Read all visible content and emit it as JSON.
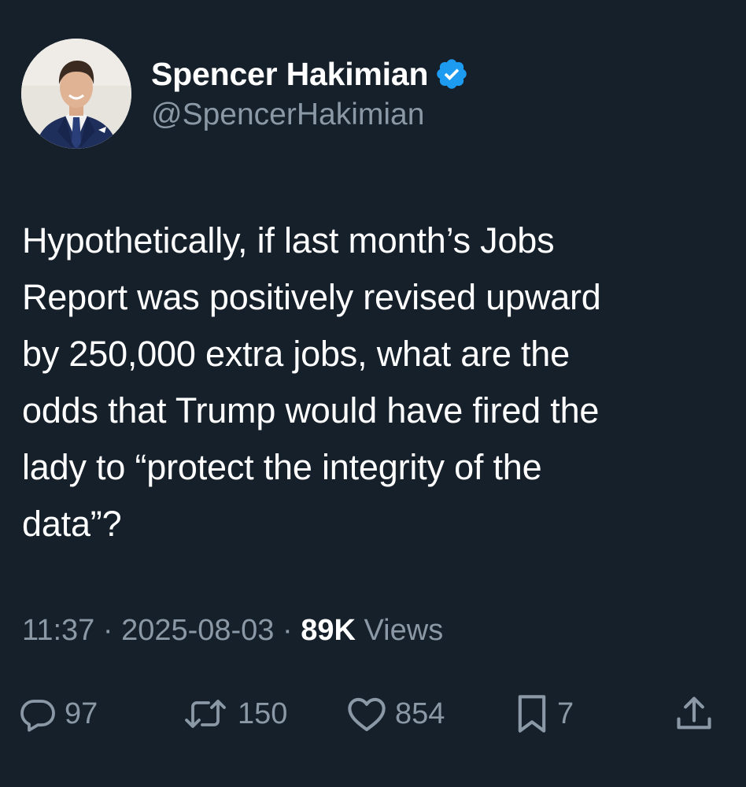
{
  "author": {
    "display_name": "Spencer Hakimian",
    "handle": "@SpencerHakimian",
    "verified": true,
    "verified_color": "#1d9bf0"
  },
  "tweet": {
    "text": "Hypothetically, if last month’s Jobs\nReport was positively revised upward\nby 250,000 extra jobs, what are the\nodds that Trump would have fired the\nlady to “protect the integrity of the\ndata”?"
  },
  "meta": {
    "time": "11:37",
    "separator": " · ",
    "date": "2025-08-03",
    "views_count": "89K",
    "views_label": " Views"
  },
  "actions": {
    "replies": "97",
    "retweets": "150",
    "likes": "854",
    "bookmarks": "7"
  },
  "colors": {
    "background": "#15202b",
    "primary_text": "#ffffff",
    "secondary_text": "#8b98a5",
    "accent": "#1d9bf0"
  },
  "icons": [
    "reply-icon",
    "retweet-icon",
    "like-icon",
    "bookmark-icon",
    "share-icon",
    "verified-badge-icon"
  ]
}
